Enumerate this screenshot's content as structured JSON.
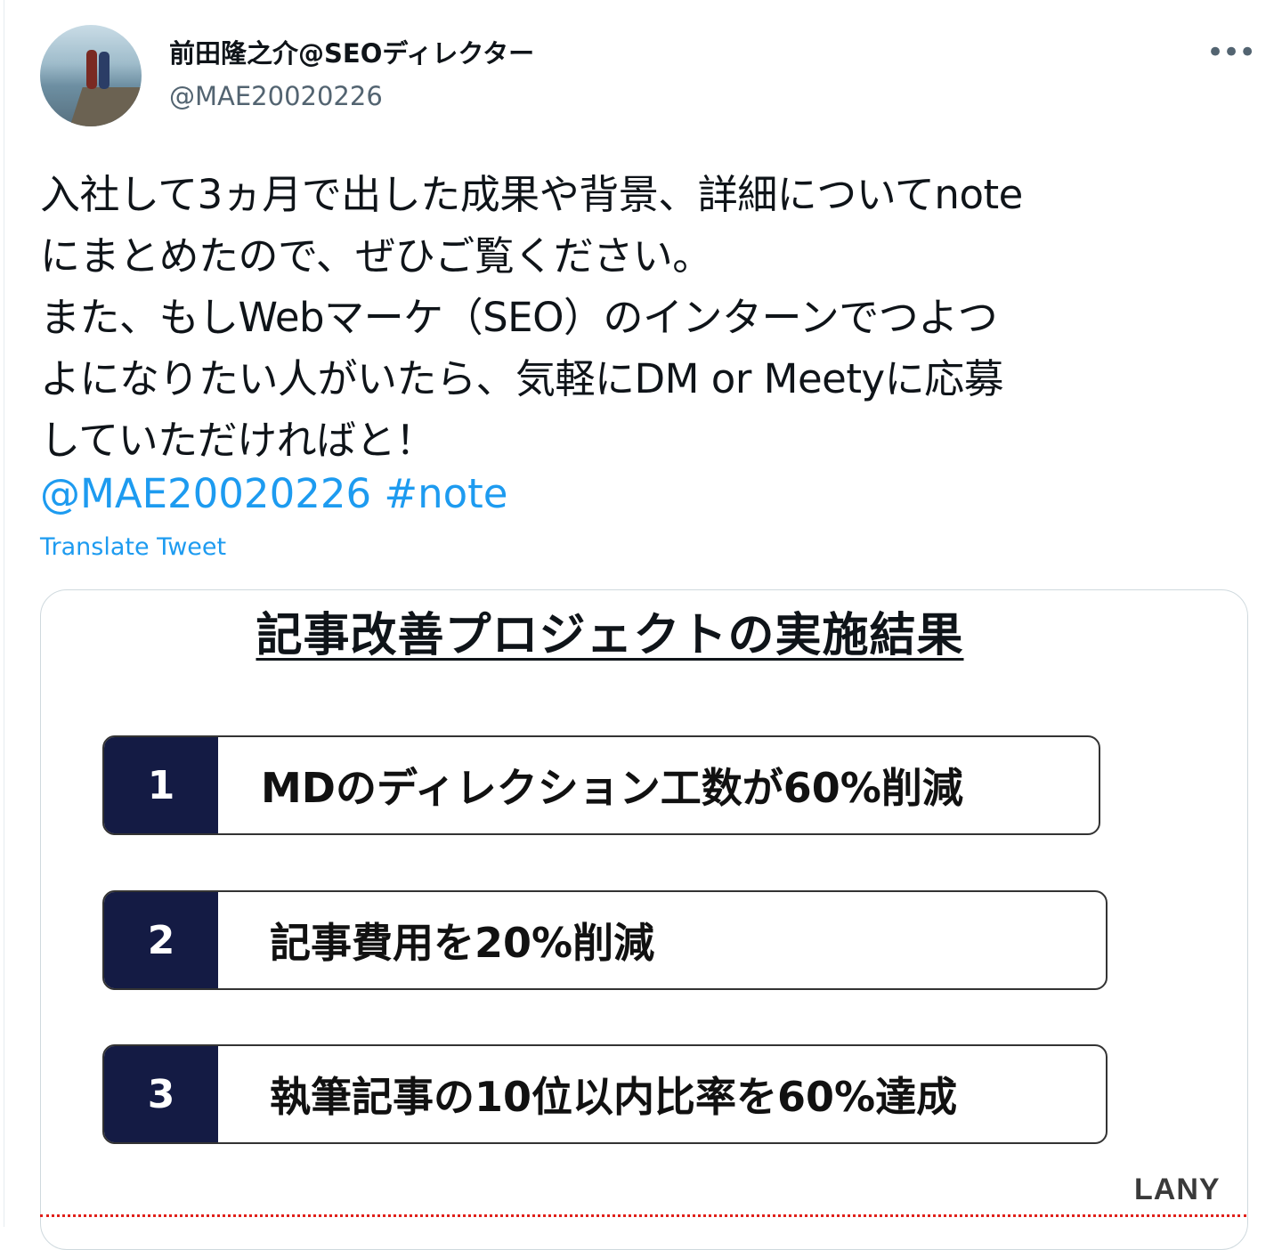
{
  "author": {
    "display_name": "前田隆之介@SEOディレクター",
    "handle": "@MAE20020226"
  },
  "menu": {
    "more_icon": "more-horizontal-icon",
    "more_label": "•••"
  },
  "tweet": {
    "text": "入社して3ヵ月で出した成果や背景、詳細についてnote\nにまとめたので、ぜひご覧ください。\nまた、もしWebマーケ（SEO）のインターンでつよつ\nよになりたい人がいたら、気軽にDM or Meetyに応募\nしていただければと！",
    "mention": "@MAE20020226",
    "hashtag": "#note",
    "translate_label": "Translate Tweet"
  },
  "media": {
    "title": "記事改善プロジェクトの実施結果",
    "items": [
      {
        "number": "1",
        "text": "MDのディレクション工数が60%削減"
      },
      {
        "number": "2",
        "text": "記事費用を20%削減"
      },
      {
        "number": "3",
        "text": "執筆記事の10位以内比率を60%達成"
      }
    ],
    "logo": "LANY"
  },
  "colors": {
    "link": "#1d9bf0",
    "number_badge": "#141b44",
    "secondary_text": "#536471",
    "dotted_line": "#e0201a"
  }
}
